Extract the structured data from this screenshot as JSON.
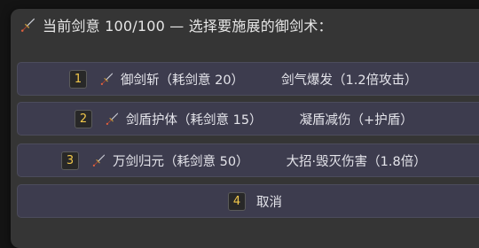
{
  "header": {
    "icon": "sword-icon",
    "text": "当前剑意 100/100 — 选择要施展的御剑术："
  },
  "options": [
    {
      "number": "1",
      "icon": "sword-icon",
      "name": "御剑斩（耗剑意 20）",
      "effect": "剑气爆发（1.2倍攻击）"
    },
    {
      "number": "2",
      "icon": "sword-icon",
      "name": "剑盾护体（耗剑意 15）",
      "effect": "凝盾减伤（+护盾）"
    },
    {
      "number": "3",
      "icon": "sword-icon",
      "name": "万剑归元（耗剑意 50）",
      "effect": "大招·毁灭伤害（1.8倍）"
    },
    {
      "number": "4",
      "name": "取消"
    }
  ],
  "colors": {
    "background": "#141414",
    "panel": "#353535",
    "option": "#3d3c4e",
    "badge_text": "#f2c84b"
  }
}
